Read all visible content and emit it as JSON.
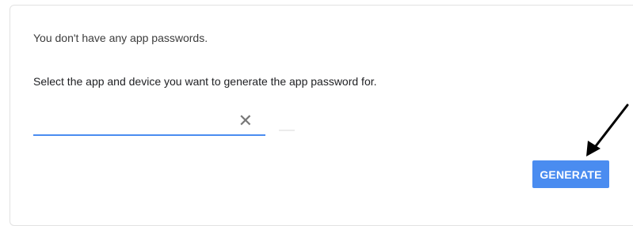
{
  "app_passwords": {
    "empty_message": "You don't have any app passwords.",
    "instruction": "Select the app and device you want to generate the app password for.",
    "select_value": "",
    "generate_label": "GENERATE"
  },
  "icons": {
    "clear": "close-icon",
    "annotation": "arrow-icon"
  },
  "colors": {
    "accent": "#4a8cf0",
    "button_text": "#ffffff",
    "text": "#202124"
  }
}
